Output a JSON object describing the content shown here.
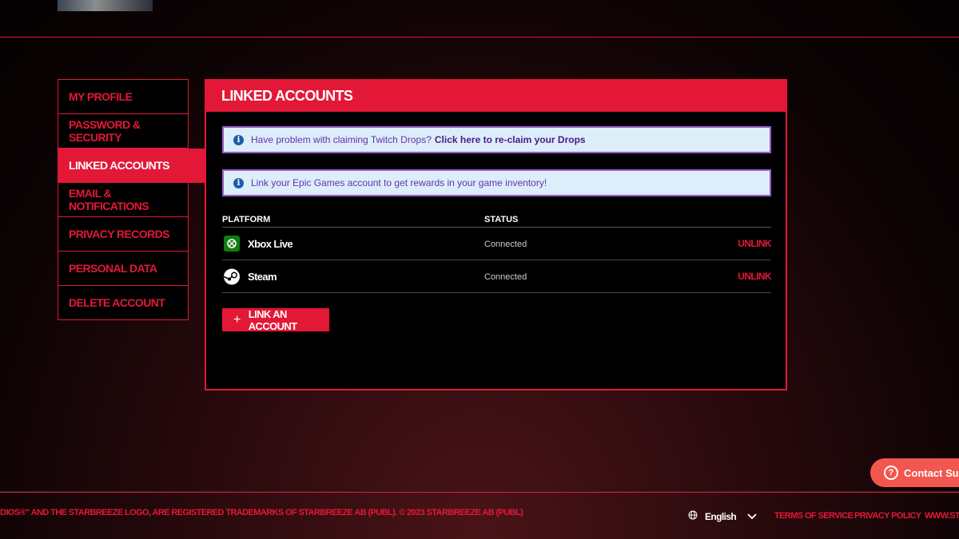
{
  "sidebar": {
    "items": [
      {
        "label": "My Profile",
        "active": false
      },
      {
        "label": "Password & Security",
        "active": false
      },
      {
        "label": "Linked Accounts",
        "active": true
      },
      {
        "label": "Email & Notifications",
        "active": false
      },
      {
        "label": "Privacy Records",
        "active": false
      },
      {
        "label": "Personal Data",
        "active": false
      },
      {
        "label": "Delete Account",
        "active": false
      }
    ]
  },
  "panel": {
    "title": "LINKED ACCOUNTS",
    "alerts": [
      {
        "text": "Have problem with claiming Twitch Drops?",
        "link": "Click here to re-claim your Drops"
      },
      {
        "text": "Link your Epic Games account to get rewards in your game inventory!"
      }
    ],
    "table": {
      "headers": {
        "platform": "PLATFORM",
        "status": "STATUS"
      },
      "rows": [
        {
          "platform": "Xbox Live",
          "icon": "xbox-icon",
          "status": "Connected",
          "action": "UNLINK"
        },
        {
          "platform": "Steam",
          "icon": "steam-icon",
          "status": "Connected",
          "action": "UNLINK"
        }
      ]
    },
    "link_button": "LINK AN ACCOUNT"
  },
  "footer": {
    "copyright": "DIOS®\" AND THE STARBREEZE LOGO, ARE REGISTERED TRADEMARKS OF STARBREEZE AB (PUBL). © 2023 STARBREEZE AB (PUBL)",
    "language": "English",
    "links": [
      "TERMS OF SERVICE",
      "PRIVACY POLICY",
      "WWW.STA"
    ]
  },
  "contact": "Contact Sup",
  "colors": {
    "accent": "#e31837",
    "alert_bg": "#dbeefa",
    "alert_border": "#9b59d0",
    "xbox": "#107c10",
    "contact": "#f2574f"
  }
}
